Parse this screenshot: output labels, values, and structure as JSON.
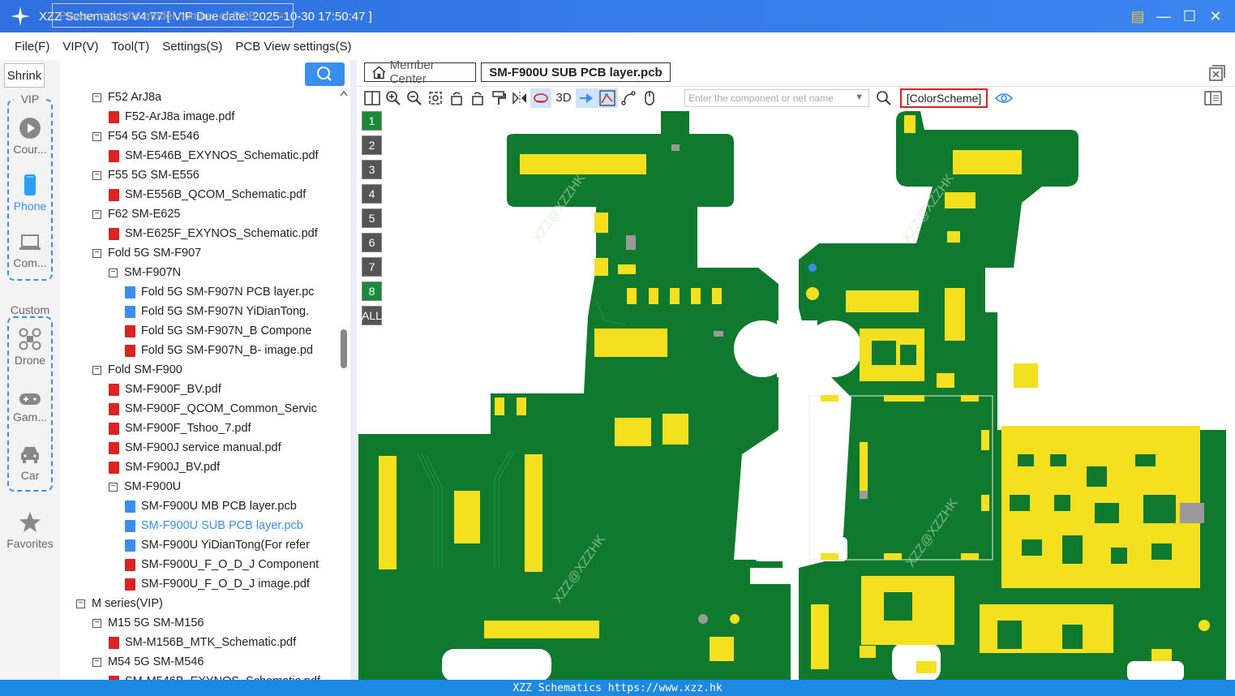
{
  "window": {
    "title": "XZZ Schematics V4.77 [ VIP Due date: 2025-10-30 17:50:47 ]"
  },
  "menu": [
    "File(F)",
    "VIP(V)",
    "Tool(T)",
    "Settings(S)",
    "PCB View settings(S)"
  ],
  "left_nav": {
    "shrink_label": "Shrink",
    "vip_label": "VIP",
    "items_vip": [
      "Cour...",
      "Phone",
      "Com..."
    ],
    "custom_label": "Custom",
    "items_custom": [
      "Drone",
      "Gam...",
      "Car"
    ],
    "favorites": "Favorites",
    "selected": "Phone"
  },
  "search": {
    "placeholder": "Please input the model number or PCB"
  },
  "tree": [
    {
      "label": "F52 ArJ8a",
      "level": 1,
      "kind": "folder"
    },
    {
      "label": "F52-ArJ8a image.pdf",
      "level": 2,
      "kind": "pdf"
    },
    {
      "label": "F54 5G SM-E546",
      "level": 1,
      "kind": "folder"
    },
    {
      "label": "SM-E546B_EXYNOS_Schematic.pdf",
      "level": 2,
      "kind": "pdf"
    },
    {
      "label": "F55 5G SM-E556",
      "level": 1,
      "kind": "folder"
    },
    {
      "label": "SM-E556B_QCOM_Schematic.pdf",
      "level": 2,
      "kind": "pdf"
    },
    {
      "label": "F62 SM-E625",
      "level": 1,
      "kind": "folder"
    },
    {
      "label": "SM-E625F_EXYNOS_Schematic.pdf",
      "level": 2,
      "kind": "pdf"
    },
    {
      "label": "Fold 5G SM-F907",
      "level": 1,
      "kind": "folder"
    },
    {
      "label": "SM-F907N",
      "level": 2,
      "kind": "folder"
    },
    {
      "label": "Fold 5G SM-F907N PCB layer.pc",
      "level": 3,
      "kind": "pcb"
    },
    {
      "label": "Fold 5G SM-F907N YiDianTong.",
      "level": 3,
      "kind": "pcb"
    },
    {
      "label": "Fold 5G SM-F907N_B Compone",
      "level": 3,
      "kind": "pdf"
    },
    {
      "label": "Fold 5G SM-F907N_B- image.pd",
      "level": 3,
      "kind": "pdf"
    },
    {
      "label": "Fold SM-F900",
      "level": 1,
      "kind": "folder"
    },
    {
      "label": "SM-F900F_BV.pdf",
      "level": 2,
      "kind": "pdf"
    },
    {
      "label": "SM-F900F_QCOM_Common_Servic",
      "level": 2,
      "kind": "pdf"
    },
    {
      "label": "SM-F900F_Tshoo_7.pdf",
      "level": 2,
      "kind": "pdf"
    },
    {
      "label": "SM-F900J service manual.pdf",
      "level": 2,
      "kind": "pdf"
    },
    {
      "label": "SM-F900J_BV.pdf",
      "level": 2,
      "kind": "pdf"
    },
    {
      "label": "SM-F900U",
      "level": 2,
      "kind": "folder"
    },
    {
      "label": "SM-F900U MB PCB layer.pcb",
      "level": 3,
      "kind": "pcb"
    },
    {
      "label": "SM-F900U SUB PCB layer.pcb",
      "level": 3,
      "kind": "pcb",
      "selected": true
    },
    {
      "label": "SM-F900U YiDianTong(For refer",
      "level": 3,
      "kind": "pcb"
    },
    {
      "label": "SM-F900U_F_O_D_J Component",
      "level": 3,
      "kind": "pdf"
    },
    {
      "label": "SM-F900U_F_O_D_J image.pdf",
      "level": 3,
      "kind": "pdf"
    },
    {
      "label": "M series(VIP)",
      "level": 0,
      "kind": "folder"
    },
    {
      "label": "M15 5G SM-M156",
      "level": 1,
      "kind": "folder"
    },
    {
      "label": "SM-M156B_MTK_Schematic.pdf",
      "level": 2,
      "kind": "pdf"
    },
    {
      "label": "M54 5G SM-M546",
      "level": 1,
      "kind": "folder"
    },
    {
      "label": "SM-M546B_EXYNOS_Schematic.pdf",
      "level": 2,
      "kind": "pdf"
    }
  ],
  "tabs": [
    {
      "label": "Member Center",
      "icon": "home-icon"
    },
    {
      "label": "SM-F900U SUB PCB layer.pcb",
      "active": true
    }
  ],
  "toolbar": {
    "three_d": "3D",
    "component_placeholder": "Enter the component or net name",
    "color_scheme": "[ColorScheme]"
  },
  "layers": [
    "1",
    "2",
    "3",
    "4",
    "5",
    "6",
    "7",
    "8",
    "ALL"
  ],
  "active_layers": [
    "1",
    "8"
  ],
  "board": {
    "watermark": "XZZ@XZZHK"
  },
  "colors": {
    "titlebar": "#2f6fe0",
    "accent": "#3b8ef0",
    "pcb_green": "#0f7a2e",
    "pad_yellow": "#f5e020",
    "statusbar": "#1e88e5"
  },
  "status": "XZZ Schematics https://www.xzz.hk"
}
